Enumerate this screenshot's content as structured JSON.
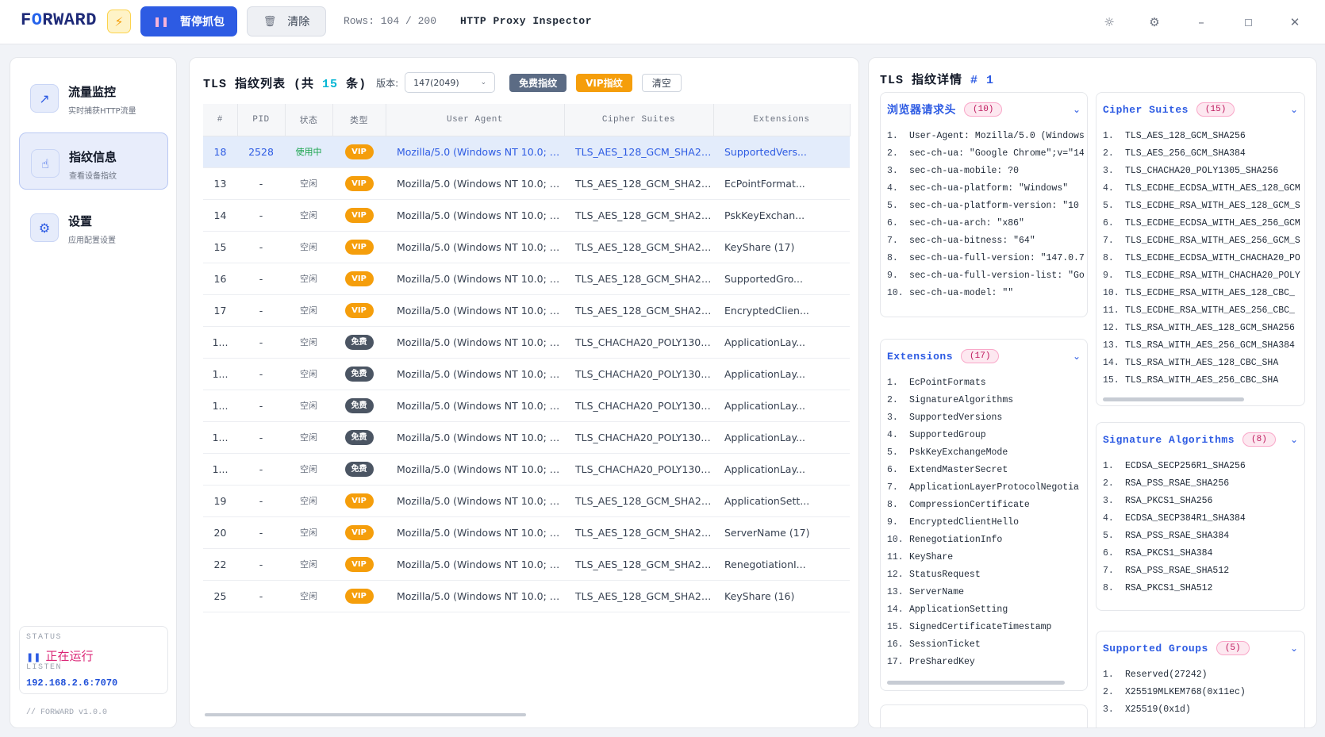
{
  "topbar": {
    "brand_pre": "F",
    "brand_o": "O",
    "brand_post": "RWARD",
    "pause_label": "暂停抓包",
    "clear_label": "清除",
    "rows_info": "Rows: 104 / 200",
    "app_title": "HTTP Proxy Inspector"
  },
  "sidebar": {
    "items": [
      {
        "title": "流量监控",
        "sub": "实时捕获HTTP流量"
      },
      {
        "title": "指纹信息",
        "sub": "查看设备指纹"
      },
      {
        "title": "设置",
        "sub": "应用配置设置"
      }
    ],
    "status_label": "STATUS",
    "status_value": "正在运行",
    "listen_label": "LISTEN",
    "listen_value": "192.168.2.6:7070",
    "version": "// FORWARD v1.0.0"
  },
  "main": {
    "title_prefix": "TLS 指纹列表 (共",
    "count": "15",
    "title_suffix": "条)",
    "version_label": "版本:",
    "version_value": "147(2049)",
    "btn_free": "免费指纹",
    "btn_vip": "VIP指纹",
    "btn_clear": "清空",
    "columns": [
      "#",
      "PID",
      "状态",
      "类型",
      "User Agent",
      "Cipher Suites",
      "Extensions"
    ],
    "rows": [
      {
        "id": "18",
        "pid": "2528",
        "state": "使用中",
        "type": "VIP",
        "ua": "Mozilla/5.0 (Windows NT 10.0; Win...",
        "cipher": "TLS_AES_128_GCM_SHA256 ...",
        "ext": "SupportedVers..."
      },
      {
        "id": "13",
        "pid": "-",
        "state": "空闲",
        "type": "VIP",
        "ua": "Mozilla/5.0 (Windows NT 10.0; Win...",
        "cipher": "TLS_AES_128_GCM_SHA256 ...",
        "ext": "EcPointFormat..."
      },
      {
        "id": "14",
        "pid": "-",
        "state": "空闲",
        "type": "VIP",
        "ua": "Mozilla/5.0 (Windows NT 10.0; Win...",
        "cipher": "TLS_AES_128_GCM_SHA256 ...",
        "ext": "PskKeyExchan..."
      },
      {
        "id": "15",
        "pid": "-",
        "state": "空闲",
        "type": "VIP",
        "ua": "Mozilla/5.0 (Windows NT 10.0; Win...",
        "cipher": "TLS_AES_128_GCM_SHA256 ...",
        "ext": "KeyShare (17)"
      },
      {
        "id": "16",
        "pid": "-",
        "state": "空闲",
        "type": "VIP",
        "ua": "Mozilla/5.0 (Windows NT 10.0; Win...",
        "cipher": "TLS_AES_128_GCM_SHA256 ...",
        "ext": "SupportedGro..."
      },
      {
        "id": "17",
        "pid": "-",
        "state": "空闲",
        "type": "VIP",
        "ua": "Mozilla/5.0 (Windows NT 10.0; Win...",
        "cipher": "TLS_AES_128_GCM_SHA256 ...",
        "ext": "EncryptedClien..."
      },
      {
        "id": "1...",
        "pid": "-",
        "state": "空闲",
        "type": "免费",
        "ua": "Mozilla/5.0 (Windows NT 10.0; Win...",
        "cipher": "TLS_CHACHA20_POLY1305_...",
        "ext": "ApplicationLay..."
      },
      {
        "id": "1...",
        "pid": "-",
        "state": "空闲",
        "type": "免费",
        "ua": "Mozilla/5.0 (Windows NT 10.0; Win...",
        "cipher": "TLS_CHACHA20_POLY1305_...",
        "ext": "ApplicationLay..."
      },
      {
        "id": "1...",
        "pid": "-",
        "state": "空闲",
        "type": "免费",
        "ua": "Mozilla/5.0 (Windows NT 10.0; Win...",
        "cipher": "TLS_CHACHA20_POLY1305_...",
        "ext": "ApplicationLay..."
      },
      {
        "id": "1...",
        "pid": "-",
        "state": "空闲",
        "type": "免费",
        "ua": "Mozilla/5.0 (Windows NT 10.0; Win...",
        "cipher": "TLS_CHACHA20_POLY1305_...",
        "ext": "ApplicationLay..."
      },
      {
        "id": "1...",
        "pid": "-",
        "state": "空闲",
        "type": "免费",
        "ua": "Mozilla/5.0 (Windows NT 10.0; Win...",
        "cipher": "TLS_CHACHA20_POLY1305_...",
        "ext": "ApplicationLay..."
      },
      {
        "id": "19",
        "pid": "-",
        "state": "空闲",
        "type": "VIP",
        "ua": "Mozilla/5.0 (Windows NT 10.0; Win...",
        "cipher": "TLS_AES_128_GCM_SHA256 ...",
        "ext": "ApplicationSett..."
      },
      {
        "id": "20",
        "pid": "-",
        "state": "空闲",
        "type": "VIP",
        "ua": "Mozilla/5.0 (Windows NT 10.0; Win...",
        "cipher": "TLS_AES_128_GCM_SHA256 ...",
        "ext": "ServerName (17)"
      },
      {
        "id": "22",
        "pid": "-",
        "state": "空闲",
        "type": "VIP",
        "ua": "Mozilla/5.0 (Windows NT 10.0; Win...",
        "cipher": "TLS_AES_128_GCM_SHA256 ...",
        "ext": "RenegotiationI..."
      },
      {
        "id": "25",
        "pid": "-",
        "state": "空闲",
        "type": "VIP",
        "ua": "Mozilla/5.0 (Windows NT 10.0; Win...",
        "cipher": "TLS_AES_128_GCM_SHA256 ...",
        "ext": "KeyShare (16)"
      }
    ]
  },
  "detail": {
    "title": "TLS 指纹详情",
    "index": "# 1",
    "headers_card": {
      "title": "浏览器请求头",
      "count": "(10)",
      "items": [
        "User-Agent: Mozilla/5.0 (Windows",
        "sec-ch-ua: \"Google Chrome\";v=\"14",
        "sec-ch-ua-mobile: ?0",
        "sec-ch-ua-platform: \"Windows\"",
        "sec-ch-ua-platform-version: \"10",
        "sec-ch-ua-arch: \"x86\"",
        "sec-ch-ua-bitness: \"64\"",
        "sec-ch-ua-full-version: \"147.0.7",
        "sec-ch-ua-full-version-list: \"Go",
        "sec-ch-ua-model: \"\""
      ]
    },
    "extensions_card": {
      "title": "Extensions",
      "count": "(17)",
      "items": [
        "EcPointFormats",
        "SignatureAlgorithms",
        "SupportedVersions",
        "SupportedGroup",
        "PskKeyExchangeMode",
        "ExtendMasterSecret",
        "ApplicationLayerProtocolNegotia",
        "CompressionCertificate",
        "EncryptedClientHello",
        "RenegotiationInfo",
        "KeyShare",
        "StatusRequest",
        "ServerName",
        "ApplicationSetting",
        "SignedCertificateTimestamp",
        "SessionTicket",
        "PreSharedKey"
      ]
    },
    "cipher_card": {
      "title": "Cipher Suites",
      "count": "(15)",
      "items": [
        "TLS_AES_128_GCM_SHA256",
        "TLS_AES_256_GCM_SHA384",
        "TLS_CHACHA20_POLY1305_SHA256",
        "TLS_ECDHE_ECDSA_WITH_AES_128_GCM",
        "TLS_ECDHE_RSA_WITH_AES_128_GCM_S",
        "TLS_ECDHE_ECDSA_WITH_AES_256_GCM",
        "TLS_ECDHE_RSA_WITH_AES_256_GCM_S",
        "TLS_ECDHE_ECDSA_WITH_CHACHA20_PO",
        "TLS_ECDHE_RSA_WITH_CHACHA20_POLY",
        "TLS_ECDHE_RSA_WITH_AES_128_CBC_",
        "TLS_ECDHE_RSA_WITH_AES_256_CBC_",
        "TLS_RSA_WITH_AES_128_GCM_SHA256",
        "TLS_RSA_WITH_AES_256_GCM_SHA384",
        "TLS_RSA_WITH_AES_128_CBC_SHA",
        "TLS_RSA_WITH_AES_256_CBC_SHA"
      ]
    },
    "sigalg_card": {
      "title": "Signature Algorithms",
      "count": "(8)",
      "items": [
        "ECDSA_SECP256R1_SHA256",
        "RSA_PSS_RSAE_SHA256",
        "RSA_PKCS1_SHA256",
        "ECDSA_SECP384R1_SHA384",
        "RSA_PSS_RSAE_SHA384",
        "RSA_PKCS1_SHA384",
        "RSA_PSS_RSAE_SHA512",
        "RSA_PKCS1_SHA512"
      ]
    },
    "groups_card": {
      "title": "Supported Groups",
      "count": "(5)",
      "items": [
        "Reserved(27242)",
        "X25519MLKEM768(0x11ec)",
        "X25519(0x1d)"
      ]
    }
  }
}
